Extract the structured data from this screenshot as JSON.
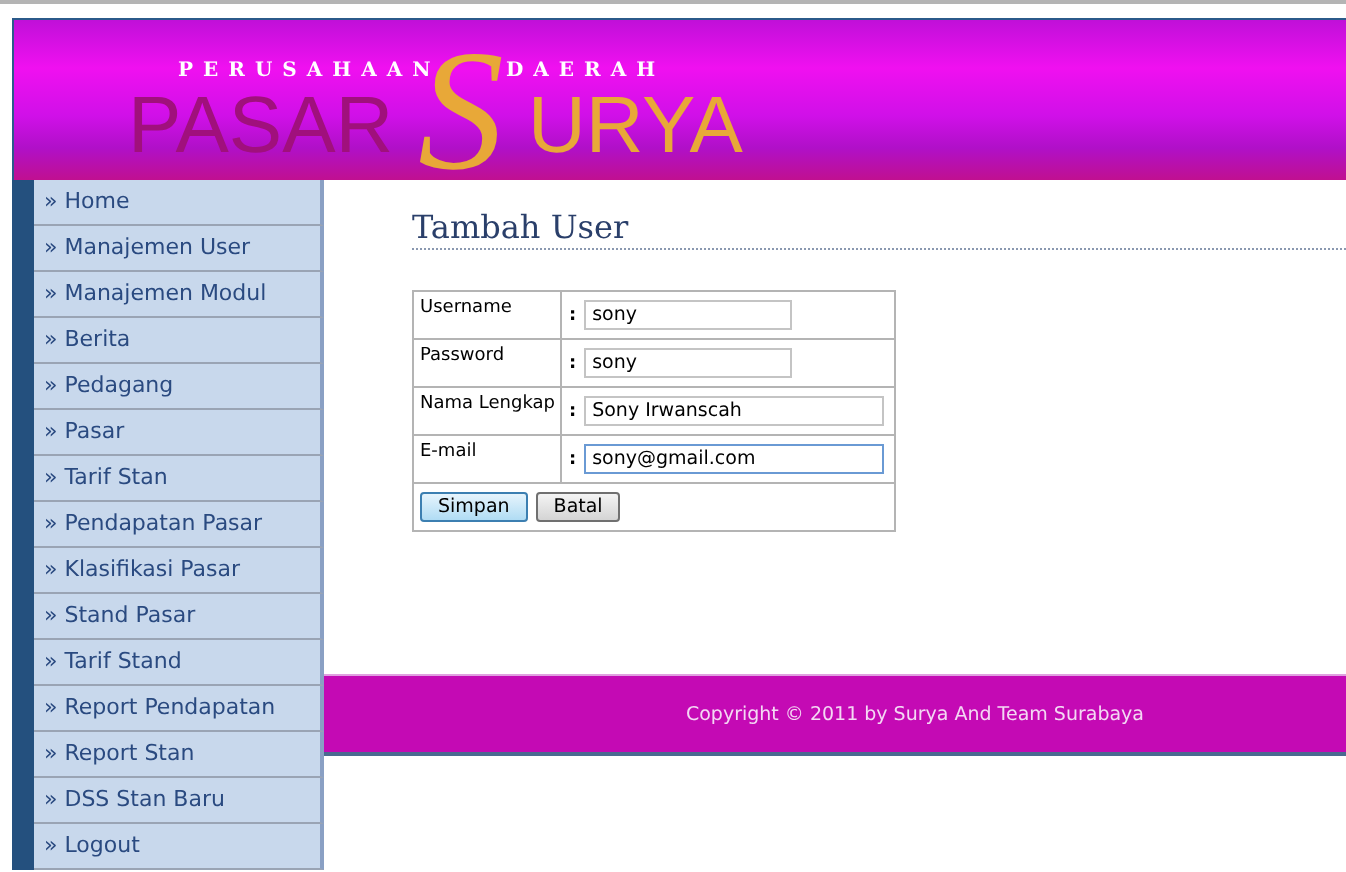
{
  "header": {
    "tagline_left": "PERUSAHAAN",
    "tagline_right": "DAERAH",
    "brand_left": "PASAR",
    "brand_initial": "S",
    "brand_right": "URYA"
  },
  "sidebar": {
    "items": [
      {
        "label": "» Home"
      },
      {
        "label": "» Manajemen User"
      },
      {
        "label": "» Manajemen Modul"
      },
      {
        "label": "» Berita"
      },
      {
        "label": "» Pedagang"
      },
      {
        "label": "» Pasar"
      },
      {
        "label": "» Tarif Stan"
      },
      {
        "label": "» Pendapatan Pasar"
      },
      {
        "label": "» Klasifikasi Pasar"
      },
      {
        "label": "» Stand Pasar"
      },
      {
        "label": "» Tarif Stand"
      },
      {
        "label": "» Report Pendapatan"
      },
      {
        "label": "» Report Stan"
      },
      {
        "label": "» DSS Stan Baru"
      },
      {
        "label": "» Logout"
      }
    ]
  },
  "page_title": "Tambah User",
  "form": {
    "fields": [
      {
        "label": "Username",
        "separator": ":",
        "value": "sony",
        "wide": false,
        "focused": false
      },
      {
        "label": "Password",
        "separator": ":",
        "value": "sony",
        "wide": false,
        "focused": false
      },
      {
        "label": "Nama Lengkap",
        "separator": ":",
        "value": "Sony Irwanscah",
        "wide": true,
        "focused": false
      },
      {
        "label": "E-mail",
        "separator": ":",
        "value": "sony@gmail.com",
        "wide": true,
        "focused": true
      }
    ],
    "buttons": [
      {
        "label": "Simpan",
        "default": true
      },
      {
        "label": "Batal",
        "default": false
      }
    ]
  },
  "footer": {
    "text": "Copyright © 2011 by Surya And Team Surabaya"
  }
}
